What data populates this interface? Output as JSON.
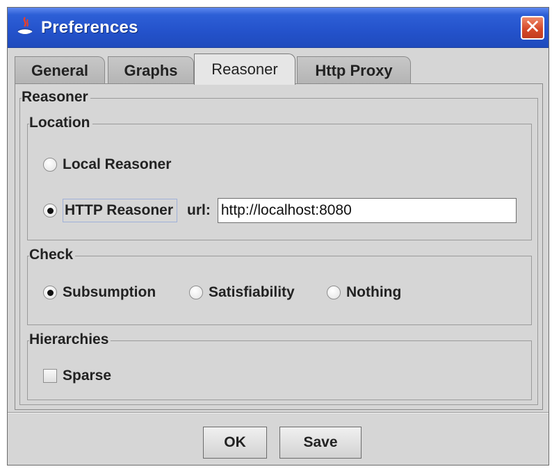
{
  "window": {
    "title": "Preferences",
    "close_glyph": "✕",
    "app_icon": "java-cup-icon"
  },
  "tabs": [
    {
      "label": "General",
      "active": false
    },
    {
      "label": "Graphs",
      "active": false
    },
    {
      "label": "Reasoner",
      "active": true
    },
    {
      "label": "Http Proxy",
      "active": false
    }
  ],
  "panel": {
    "title": "Reasoner",
    "location": {
      "title": "Location",
      "local_label": "Local Reasoner",
      "local_checked": false,
      "http_label": "HTTP Reasoner",
      "http_checked": true,
      "url_label": "url:",
      "url_value": "http://localhost:8080"
    },
    "check": {
      "title": "Check",
      "options": [
        {
          "label": "Subsumption",
          "checked": true
        },
        {
          "label": "Satisfiability",
          "checked": false
        },
        {
          "label": "Nothing",
          "checked": false
        }
      ]
    },
    "hierarchies": {
      "title": "Hierarchies",
      "sparse_label": "Sparse",
      "sparse_checked": false
    }
  },
  "buttons": {
    "ok_label": "OK",
    "save_label": "Save"
  },
  "colors": {
    "titlebar": "#2452cb",
    "close": "#d64a2a",
    "dialog_bg": "#d6d6d6"
  }
}
